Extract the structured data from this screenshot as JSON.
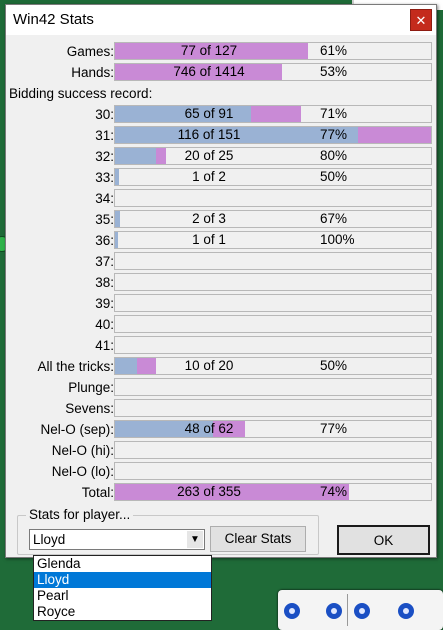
{
  "window": {
    "title": "Win42 Stats",
    "close_label": "✕"
  },
  "summary_rows": [
    {
      "label": "Games:",
      "count": "77 of 127",
      "pct": "61%",
      "blue": 0.0,
      "purple": 0.61
    },
    {
      "label": "Hands:",
      "count": "746 of 1414",
      "pct": "53%",
      "blue": 0.0,
      "purple": 0.53
    }
  ],
  "bidding_header": "Bidding success record:",
  "bid_rows": [
    {
      "label": "30:",
      "count": "65 of 91",
      "pct": "71%",
      "blue": 0.43,
      "purple": 0.59
    },
    {
      "label": "31:",
      "count": "116 of 151",
      "pct": "77%",
      "blue": 0.77,
      "purple": 1.0
    },
    {
      "label": "32:",
      "count": "20 of 25",
      "pct": "80%",
      "blue": 0.13,
      "purple": 0.16
    },
    {
      "label": "33:",
      "count": "1 of 2",
      "pct": "50%",
      "blue": 0.012,
      "purple": 0.012
    },
    {
      "label": "34:",
      "count": "",
      "pct": "",
      "blue": 0,
      "purple": 0
    },
    {
      "label": "35:",
      "count": "2 of 3",
      "pct": "67%",
      "blue": 0.016,
      "purple": 0.016
    },
    {
      "label": "36:",
      "count": "1 of 1",
      "pct": "100%",
      "blue": 0.01,
      "purple": 0.01
    },
    {
      "label": "37:",
      "count": "",
      "pct": "",
      "blue": 0,
      "purple": 0
    },
    {
      "label": "38:",
      "count": "",
      "pct": "",
      "blue": 0,
      "purple": 0
    },
    {
      "label": "39:",
      "count": "",
      "pct": "",
      "blue": 0,
      "purple": 0
    },
    {
      "label": "40:",
      "count": "",
      "pct": "",
      "blue": 0,
      "purple": 0
    },
    {
      "label": "41:",
      "count": "",
      "pct": "",
      "blue": 0,
      "purple": 0
    },
    {
      "label": "All the tricks:",
      "count": "10 of 20",
      "pct": "50%",
      "blue": 0.07,
      "purple": 0.13
    },
    {
      "label": "Plunge:",
      "count": "",
      "pct": "",
      "blue": 0,
      "purple": 0
    },
    {
      "label": "Sevens:",
      "count": "",
      "pct": "",
      "blue": 0,
      "purple": 0
    },
    {
      "label": "Nel-O (sep):",
      "count": "48 of 62",
      "pct": "77%",
      "blue": 0.31,
      "purple": 0.41
    },
    {
      "label": "Nel-O (hi):",
      "count": "",
      "pct": "",
      "blue": 0,
      "purple": 0
    },
    {
      "label": "Nel-O (lo):",
      "count": "",
      "pct": "",
      "blue": 0,
      "purple": 0
    },
    {
      "label": "Total:",
      "count": "263 of 355",
      "pct": "74%",
      "blue": 0.0,
      "purple": 0.74
    }
  ],
  "player_group": {
    "label": "Stats for player...",
    "selected": "Lloyd",
    "options": [
      "Glenda",
      "Lloyd",
      "Pearl",
      "Royce"
    ]
  },
  "buttons": {
    "clear_label": "Clear Stats",
    "ok_label": "OK"
  },
  "colors": {
    "blue_fill": "#9ab2d4",
    "purple_fill": "#c98ad6"
  }
}
